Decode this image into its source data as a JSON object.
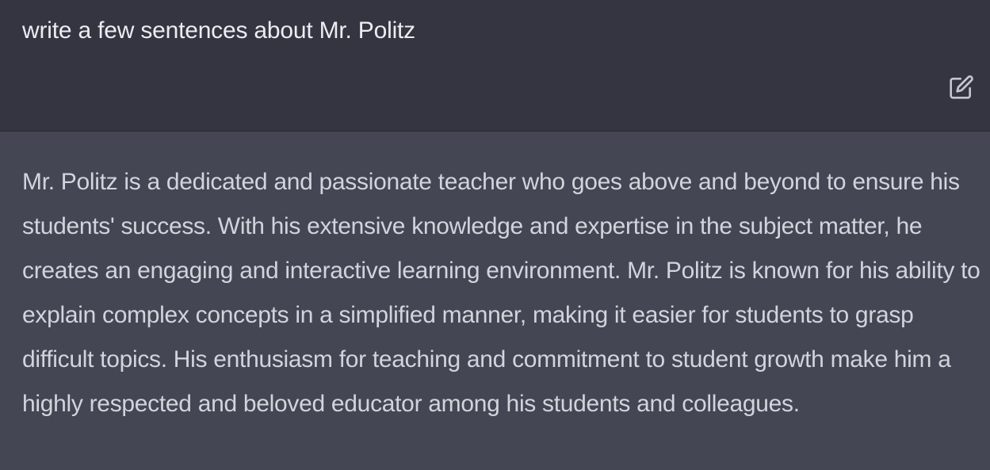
{
  "conversation": {
    "user_message": "write a few sentences about Mr. Politz",
    "assistant_message": "Mr. Politz is a dedicated and passionate teacher who goes above and beyond to ensure his students' success. With his extensive knowledge and expertise in the subject matter, he creates an engaging and interactive learning environment. Mr. Politz is known for his ability to explain complex concepts in a simplified manner, making it easier for students to grasp difficult topics. His enthusiasm for teaching and commitment to student growth make him a highly respected and beloved educator among his students and colleagues."
  },
  "icons": {
    "edit": "edit-icon"
  },
  "colors": {
    "user_bg": "#343541",
    "assistant_bg": "#444654",
    "user_text": "#ececf1",
    "assistant_text": "#d1d5db",
    "icon": "#c5c5d2"
  }
}
